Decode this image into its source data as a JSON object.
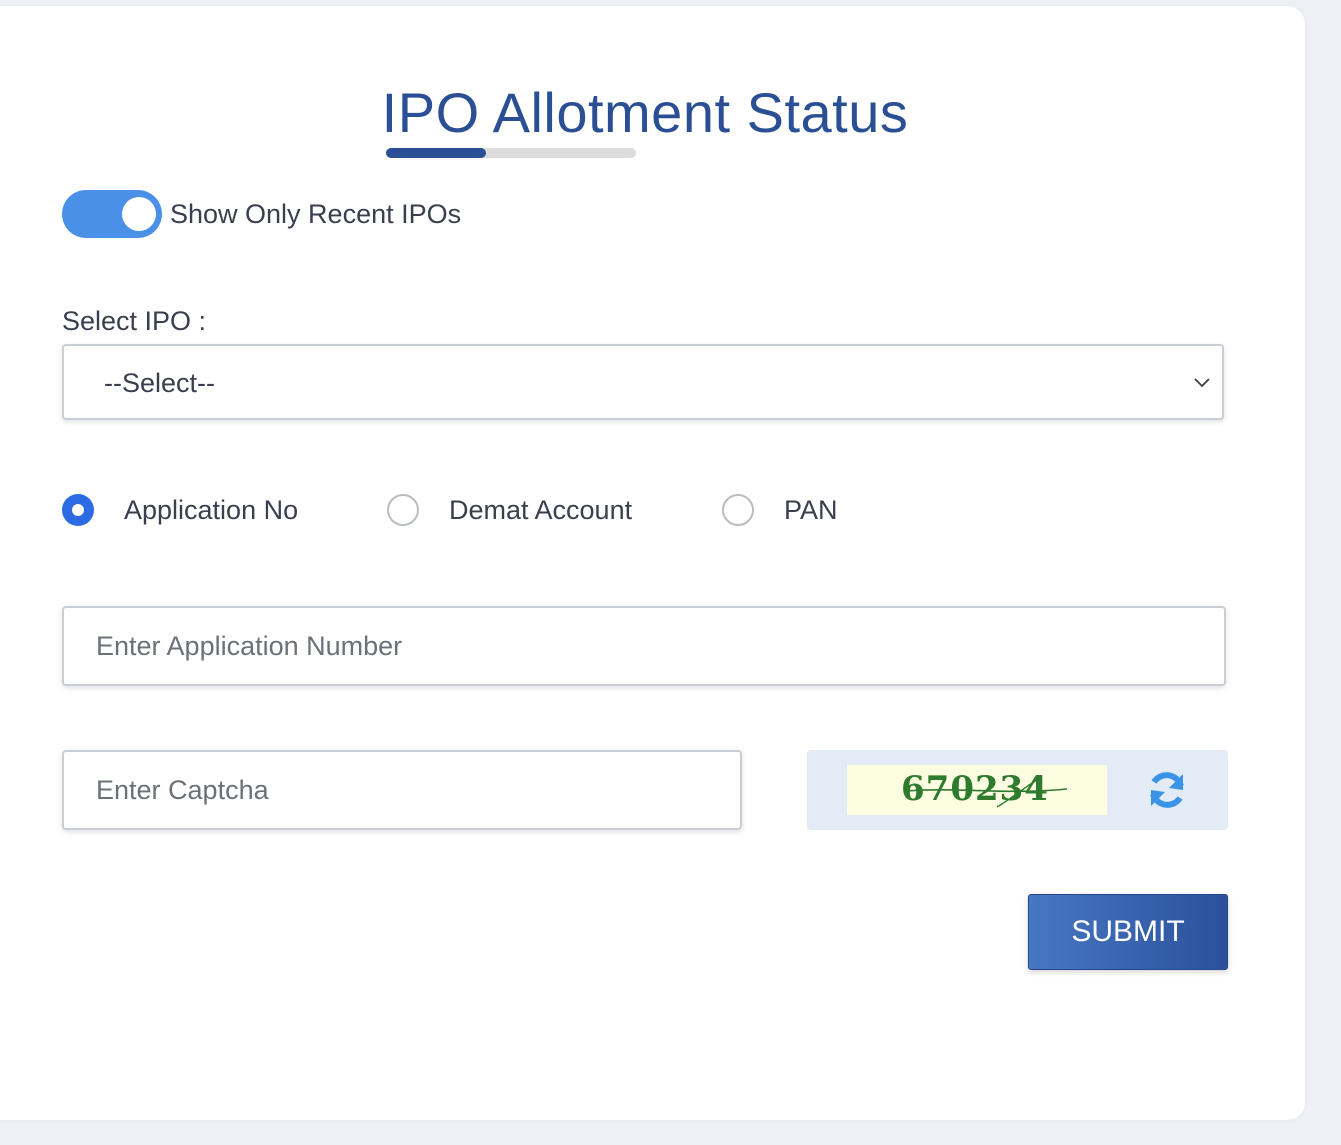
{
  "page": {
    "title": "IPO Allotment Status"
  },
  "toggle": {
    "label": "Show Only Recent IPOs",
    "checked": true
  },
  "select_ipo": {
    "label": "Select IPO :",
    "value": "--Select--"
  },
  "search_by": {
    "options": [
      {
        "label": "Application No",
        "checked": true
      },
      {
        "label": "Demat Account",
        "checked": false
      },
      {
        "label": "PAN",
        "checked": false
      }
    ]
  },
  "application_input": {
    "placeholder": "Enter Application Number",
    "value": ""
  },
  "captcha": {
    "placeholder": "Enter Captcha",
    "value": "",
    "code": "670234",
    "refresh_icon": "refresh-icon"
  },
  "submit": {
    "label": "SUBMIT"
  },
  "colors": {
    "brand": "#2b4f95",
    "toggle_on": "#4a90e8",
    "radio_checked": "#2d6be4",
    "captcha_text": "#2e7a2e"
  }
}
